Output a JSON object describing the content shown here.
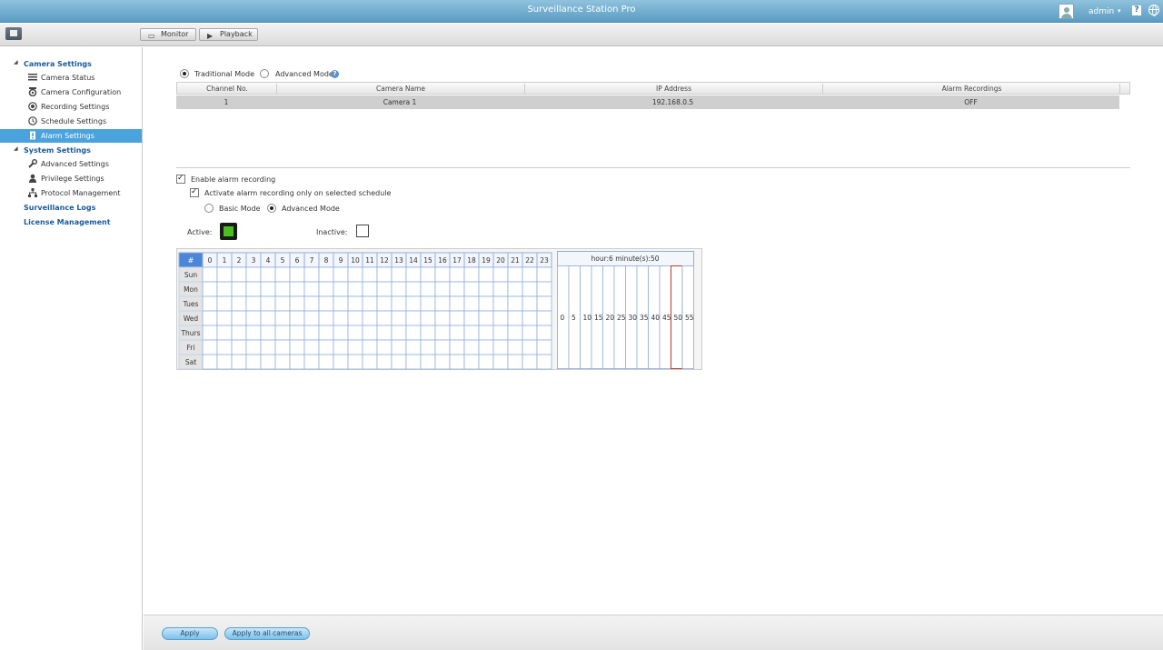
{
  "app": {
    "title": "Surveillance Station Pro",
    "user": "admin"
  },
  "toolbar": {
    "monitor": "Monitor",
    "playback": "Playback"
  },
  "sidebar": {
    "camera_settings": "Camera Settings",
    "camera_items": [
      {
        "label": "Camera Status",
        "icon": "list-icon"
      },
      {
        "label": "Camera Configuration",
        "icon": "camera-icon"
      },
      {
        "label": "Recording Settings",
        "icon": "record-icon"
      },
      {
        "label": "Schedule Settings",
        "icon": "clock-icon"
      },
      {
        "label": "Alarm Settings",
        "icon": "alarm-icon",
        "active": true
      }
    ],
    "system_settings": "System Settings",
    "system_items": [
      {
        "label": "Advanced Settings",
        "icon": "wrench-icon"
      },
      {
        "label": "Privilege Settings",
        "icon": "user-icon"
      },
      {
        "label": "Protocol Management",
        "icon": "network-icon"
      }
    ],
    "surveillance_logs": "Surveillance Logs",
    "license_management": "License Management"
  },
  "mode": {
    "traditional": "Traditional Mode",
    "advanced": "Advanced Mode",
    "selected": "traditional"
  },
  "camera_table": {
    "headers": [
      "Channel No.",
      "Camera Name",
      "IP Address",
      "Alarm Recordings"
    ],
    "rows": [
      [
        "1",
        "Camera 1",
        "192.168.0.5",
        "OFF"
      ]
    ]
  },
  "alarm": {
    "enable_label": "Enable alarm recording",
    "enable_checked": true,
    "schedule_label": "Activate alarm recording only on selected schedule",
    "schedule_checked": true,
    "basic_mode": "Basic Mode",
    "advanced_mode": "Advanced Mode",
    "selected_mode": "advanced",
    "active_label": "Active:",
    "inactive_label": "Inactive:",
    "active_color": "#4bbf1f"
  },
  "schedule": {
    "corner": "#",
    "hours": [
      "0",
      "1",
      "2",
      "3",
      "4",
      "5",
      "6",
      "7",
      "8",
      "9",
      "10",
      "11",
      "12",
      "13",
      "14",
      "15",
      "16",
      "17",
      "18",
      "19",
      "20",
      "21",
      "22",
      "23"
    ],
    "days": [
      "Sun",
      "Mon",
      "Tues",
      "Wed",
      "Thurs",
      "Fri",
      "Sat"
    ],
    "minute_header": "hour:6 minute(s):50",
    "minutes": [
      "0",
      "5",
      "10",
      "15",
      "20",
      "25",
      "30",
      "35",
      "40",
      "45",
      "50",
      "55"
    ],
    "selected_minute_index": 10
  },
  "footer": {
    "apply": "Apply",
    "apply_all": "Apply to all cameras"
  }
}
